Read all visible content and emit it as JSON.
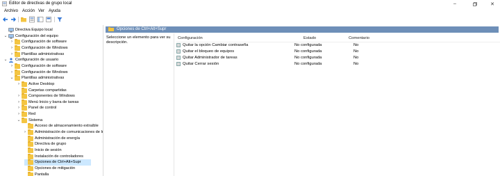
{
  "window": {
    "title": "Editor de directivas de grupo local"
  },
  "menu": [
    "Archivo",
    "Acción",
    "Ver",
    "Ayuda"
  ],
  "toolbar_icons": [
    "back-icon",
    "forward-icon",
    "folder-up-icon",
    "properties-icon",
    "show-hide-tree-icon",
    "help-icon",
    "filter-icon"
  ],
  "tree": [
    {
      "label": "Directiva Equipo local",
      "level": 0,
      "chevron": "",
      "icon": "computer"
    },
    {
      "label": "Configuración del equipo",
      "level": 0,
      "chevron": "down",
      "icon": "computer"
    },
    {
      "label": "Configuración de software",
      "level": 1,
      "chevron": "right",
      "icon": "folder"
    },
    {
      "label": "Configuración de Windows",
      "level": 1,
      "chevron": "right",
      "icon": "folder"
    },
    {
      "label": "Plantillas administrativas",
      "level": 1,
      "chevron": "right",
      "icon": "folder"
    },
    {
      "label": "Configuración de usuario",
      "level": 0,
      "chevron": "down",
      "icon": "user"
    },
    {
      "label": "Configuración de software",
      "level": 1,
      "chevron": "right",
      "icon": "folder"
    },
    {
      "label": "Configuración de Windows",
      "level": 1,
      "chevron": "right",
      "icon": "folder"
    },
    {
      "label": "Plantillas administrativas",
      "level": 1,
      "chevron": "down",
      "icon": "folder"
    },
    {
      "label": "Active Desktop",
      "level": 2,
      "chevron": "right",
      "icon": "folder"
    },
    {
      "label": "Carpetas compartidas",
      "level": 2,
      "chevron": "",
      "icon": "folder"
    },
    {
      "label": "Componentes de Windows",
      "level": 2,
      "chevron": "right",
      "icon": "folder"
    },
    {
      "label": "Menú Inicio y barra de tareas",
      "level": 2,
      "chevron": "right",
      "icon": "folder"
    },
    {
      "label": "Panel de control",
      "level": 2,
      "chevron": "right",
      "icon": "folder"
    },
    {
      "label": "Red",
      "level": 2,
      "chevron": "right",
      "icon": "folder"
    },
    {
      "label": "Sistema",
      "level": 2,
      "chevron": "down",
      "icon": "folder"
    },
    {
      "label": "Acceso de almacenamiento extraíble",
      "level": 3,
      "chevron": "",
      "icon": "folder"
    },
    {
      "label": "Administración de comunicaciones de Ir",
      "level": 3,
      "chevron": "right",
      "icon": "folder"
    },
    {
      "label": "Administración de energía",
      "level": 3,
      "chevron": "",
      "icon": "folder"
    },
    {
      "label": "Directiva de grupo",
      "level": 3,
      "chevron": "",
      "icon": "folder"
    },
    {
      "label": "Inicio de sesión",
      "level": 3,
      "chevron": "",
      "icon": "folder"
    },
    {
      "label": "Instalación de controladores",
      "level": 3,
      "chevron": "",
      "icon": "folder"
    },
    {
      "label": "Opciones de Ctrl+Alt+Supr",
      "level": 3,
      "chevron": "",
      "icon": "folder",
      "selected": true
    },
    {
      "label": "Opciones de mitigación",
      "level": 3,
      "chevron": "",
      "icon": "folder"
    },
    {
      "label": "Pantalla",
      "level": 3,
      "chevron": "",
      "icon": "folder"
    }
  ],
  "panel": {
    "path_title": "Opciones de Ctrl+Alt+Supr",
    "description": "Seleccione un elemento para ver su descripción.",
    "columns": {
      "setting": "Configuración",
      "state": "Estado",
      "comment": "Comentario"
    },
    "rows": [
      {
        "name": "Quitar la opción Cambiar contraseña",
        "state": "No configurada",
        "comment": "No"
      },
      {
        "name": "Quitar el bloqueo de equipos",
        "state": "No configurada",
        "comment": "No"
      },
      {
        "name": "Quitar Administrador de tareas",
        "state": "No configurada",
        "comment": "No"
      },
      {
        "name": "Quitar Cerrar sesión",
        "state": "No configurada",
        "comment": "No"
      }
    ]
  },
  "colors": {
    "path_bar": "#6e8fb8",
    "selection": "#cce8ff",
    "folder": "#f4c542"
  }
}
